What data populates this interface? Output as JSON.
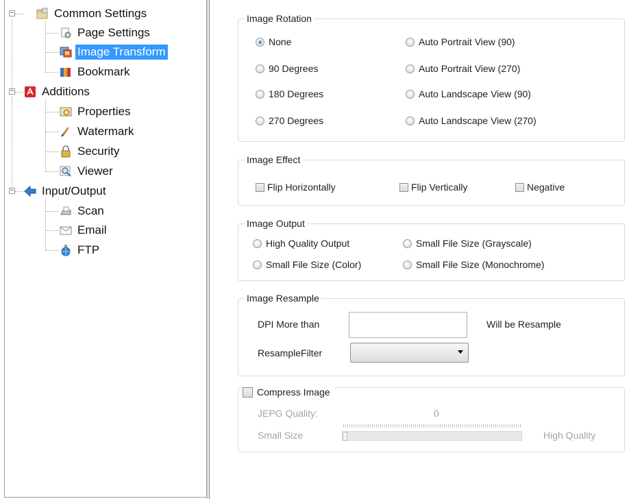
{
  "tree": {
    "items": [
      {
        "label": "Common Settings",
        "icon": "settings-folder-icon"
      },
      {
        "label": "Page Settings",
        "icon": "page-settings-icon"
      },
      {
        "label": "Image Transform",
        "icon": "image-transform-icon",
        "selected": true
      },
      {
        "label": "Bookmark",
        "icon": "bookmark-icon"
      },
      {
        "label": "Additions",
        "icon": "pdf-additions-icon"
      },
      {
        "label": "Properties",
        "icon": "properties-icon"
      },
      {
        "label": "Watermark",
        "icon": "watermark-icon"
      },
      {
        "label": "Security",
        "icon": "security-lock-icon"
      },
      {
        "label": "Viewer",
        "icon": "viewer-magnifier-icon"
      },
      {
        "label": "Input/Output",
        "icon": "input-output-arrow-icon"
      },
      {
        "label": "Scan",
        "icon": "scanner-icon"
      },
      {
        "label": "Email",
        "icon": "email-envelope-icon"
      },
      {
        "label": "FTP",
        "icon": "ftp-globe-icon"
      }
    ],
    "expander_symbol": "−"
  },
  "rotation": {
    "title": "Image Rotation",
    "options": [
      {
        "label": "None",
        "checked": true
      },
      {
        "label": "90 Degrees",
        "checked": false
      },
      {
        "label": "180 Degrees",
        "checked": false
      },
      {
        "label": "270 Degrees",
        "checked": false
      },
      {
        "label": "Auto Portrait View (90)",
        "checked": false
      },
      {
        "label": "Auto Portrait View (270)",
        "checked": false
      },
      {
        "label": "Auto Landscape View (90)",
        "checked": false
      },
      {
        "label": "Auto Landscape View (270)",
        "checked": false
      }
    ]
  },
  "effect": {
    "title": "Image Effect",
    "options": [
      {
        "label": "Flip Horizontally",
        "checked": false
      },
      {
        "label": "Flip Vertically",
        "checked": false
      },
      {
        "label": "Negative",
        "checked": false
      }
    ]
  },
  "output": {
    "title": "Image Output",
    "options": [
      {
        "label": "High Quality Output",
        "checked": false
      },
      {
        "label": "Small File Size (Color)",
        "checked": false
      },
      {
        "label": "Small File Size (Grayscale)",
        "checked": false
      },
      {
        "label": "Small File Size (Monochrome)",
        "checked": false
      }
    ]
  },
  "resample": {
    "title": "Image Resample",
    "dpi_label": "DPI More than",
    "dpi_value": "",
    "dpi_suffix": "Will be Resample",
    "filter_label": "ResampleFilter",
    "filter_value": ""
  },
  "compress": {
    "label": "Compress Image",
    "checked": false,
    "quality_label": "JEPG Quality:",
    "quality_value": "0",
    "slider_fraction": 0,
    "min_label": "Small Size",
    "max_label": "High Quality"
  },
  "colors": {
    "selection": "#3399ff",
    "disabled_text": "#a3a3a3",
    "group_border": "#dadada"
  }
}
